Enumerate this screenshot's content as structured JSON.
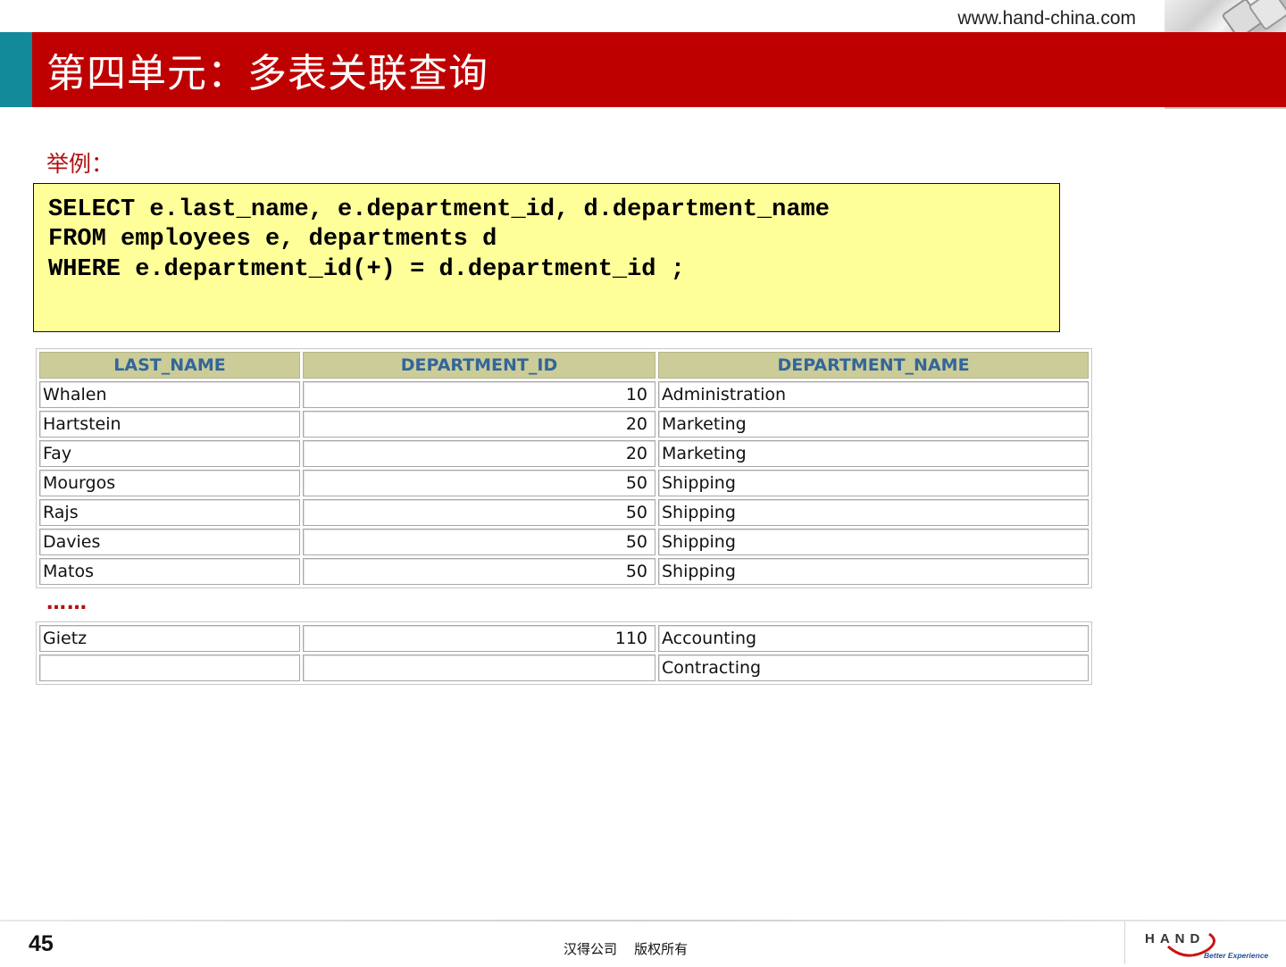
{
  "header": {
    "url": "www.hand-china.com",
    "title": "第四单元：多表关联查询"
  },
  "example_label": "举例：",
  "code": {
    "lines": [
      "SELECT e.last_name, e.department_id, d.department_name",
      "FROM employees e, departments d",
      "WHERE e.department_id(+) = d.department_id ;"
    ]
  },
  "table": {
    "headers": [
      "LAST_NAME",
      "DEPARTMENT_ID",
      "DEPARTMENT_NAME"
    ],
    "rows_top": [
      [
        "Whalen",
        "10",
        "Administration"
      ],
      [
        "Hartstein",
        "20",
        "Marketing"
      ],
      [
        "Fay",
        "20",
        "Marketing"
      ],
      [
        "Mourgos",
        "50",
        "Shipping"
      ],
      [
        "Rajs",
        "50",
        "Shipping"
      ],
      [
        "Davies",
        "50",
        "Shipping"
      ],
      [
        "Matos",
        "50",
        "Shipping"
      ]
    ],
    "ellipsis": "……",
    "rows_bottom": [
      [
        "Gietz",
        "110",
        "Accounting"
      ],
      [
        "",
        "",
        "Contracting"
      ]
    ]
  },
  "footer": {
    "page_number": "45",
    "copyright": "汉得公司    版权所有",
    "logo_text": "HAND",
    "logo_tagline": "Better Experience"
  },
  "colors": {
    "title_bar": "#bf0000",
    "accent_teal": "#138a9a",
    "code_bg": "#ffff99",
    "table_header_bg": "#cccc99",
    "table_header_text": "#336699"
  }
}
